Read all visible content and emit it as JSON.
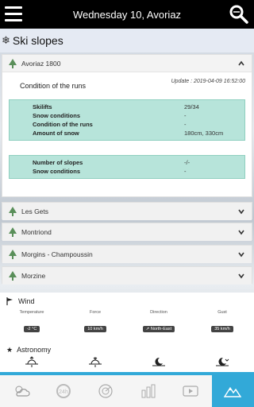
{
  "header": {
    "title": "Wednesday 10, Avoriaz"
  },
  "section": {
    "title": "Ski slopes"
  },
  "avoriaz": {
    "name": "Avoriaz 1800",
    "condition_title": "Condition of the runs",
    "update": "Update : 2019-04-09 16:52:00",
    "info_rows": [
      {
        "key": "Skilifts",
        "value": "29/34"
      },
      {
        "key": "Snow conditions",
        "value": "-"
      },
      {
        "key": "Condition of the runs",
        "value": "-"
      },
      {
        "key": "Amount of snow",
        "value": "180cm, 330cm"
      }
    ],
    "slope_rows": [
      {
        "key": "Number of slopes",
        "value": "-/-"
      },
      {
        "key": "Snow conditions",
        "value": "-"
      }
    ]
  },
  "resorts": [
    "Les Gets",
    "Montriond",
    "Morgins - Champoussin",
    "Morzine"
  ],
  "wind": {
    "title": "Wind",
    "columns": [
      {
        "label": "Temperature",
        "value": "-2 °C"
      },
      {
        "label": "Force",
        "value": "10 km/h"
      },
      {
        "label": "Direction",
        "value": "North-East"
      },
      {
        "label": "Gust",
        "value": "35 km/h"
      }
    ]
  },
  "astronomy": {
    "title": "Astronomy"
  },
  "colors": {
    "accent": "#32a9d8",
    "green_box": "#b7e4da",
    "topbar": "#000000"
  },
  "bottom_tabs": [
    "weather-icon",
    "24h-icon",
    "radar-icon",
    "chart-icon",
    "video-icon",
    "mountain-icon"
  ]
}
